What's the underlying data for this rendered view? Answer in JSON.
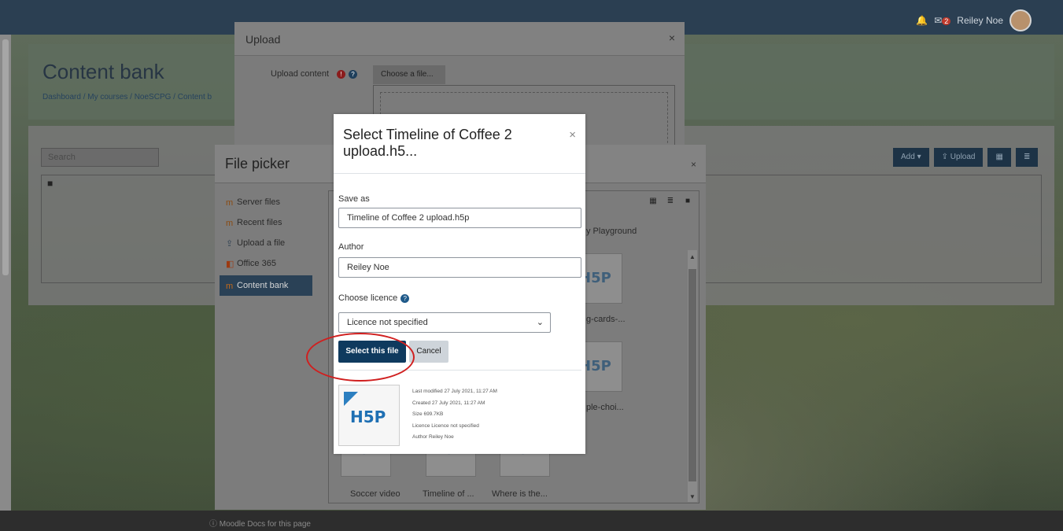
{
  "top_bar": {
    "user_name": "Reiley Noe",
    "notification_count": "2"
  },
  "page": {
    "title": "Content bank",
    "breadcrumb": "Dashboard / My courses / NoeSCPG / Content b",
    "search_placeholder": "Search",
    "add_label": "Add",
    "upload_label": "Upload"
  },
  "upload_modal": {
    "title": "Upload",
    "content_label": "Upload content",
    "choose_file_label": "Choose a file..."
  },
  "file_picker": {
    "title": "File picker",
    "repositories": [
      {
        "label": "Server files"
      },
      {
        "label": "Recent files"
      },
      {
        "label": "Upload a file"
      },
      {
        "label": "Office 365"
      },
      {
        "label": "Content bank"
      }
    ],
    "files": {
      "playground": "y Playground",
      "cards": "g-cards-...",
      "choice": "ple-choi...",
      "soccer": "Soccer video",
      "timeline": "Timeline of ...",
      "where": "Where is the..."
    }
  },
  "select_dialog": {
    "title": "Select Timeline of Coffee 2 upload.h5...",
    "save_as_label": "Save as",
    "save_as_value": "Timeline of Coffee 2 upload.h5p",
    "author_label": "Author",
    "author_value": "Reiley Noe",
    "licence_label": "Choose licence",
    "licence_value": "Licence not specified",
    "select_button": "Select this file",
    "cancel_button": "Cancel",
    "meta": {
      "last_modified": "Last modified 27 July 2021, 11:27 AM",
      "created": "Created 27 July 2021, 11:27 AM",
      "size": "Size 699.7KB",
      "licence": "Licence Licence not specified",
      "author": "Author Reiley Noe"
    }
  },
  "footer": {
    "docs_link": "Moodle Docs for this page"
  },
  "icons": {
    "close": "close-icon",
    "help": "help-icon",
    "folder": "folder-icon",
    "grid": "grid-view-icon",
    "list": "list-view-icon",
    "chevron": "chevron-down-icon"
  }
}
